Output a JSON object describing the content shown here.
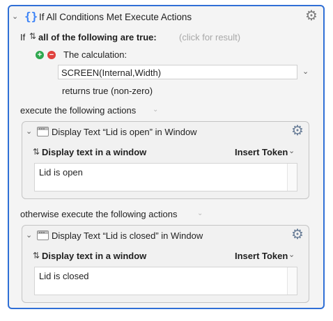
{
  "group": {
    "title": "If All Conditions Met Execute Actions",
    "if_label": "If",
    "conditions_mode": "all of the following are true:",
    "click_for_result": "(click for result)",
    "condition": {
      "label": "The calculation:",
      "expression": "SCREEN(Internal,Width)",
      "result_text": "returns true (non-zero)"
    },
    "execute_label": "execute the following actions",
    "otherwise_label": "otherwise execute the following actions"
  },
  "action_open": {
    "title": "Display Text “Lid is open” in Window",
    "mode_label": "Display text in a window",
    "insert_token": "Insert Token",
    "text": "Lid is open"
  },
  "action_closed": {
    "title": "Display Text “Lid is closed” in Window",
    "mode_label": "Display text in a window",
    "insert_token": "Insert Token",
    "text": "Lid is closed"
  },
  "icons": {
    "chevron": "⌄",
    "gear": "⚙",
    "updown": "↕",
    "plus": "+",
    "minus": "−"
  },
  "colors": {
    "accent": "#2f6fd6",
    "add": "#2fa84f",
    "remove": "#e0423e"
  }
}
